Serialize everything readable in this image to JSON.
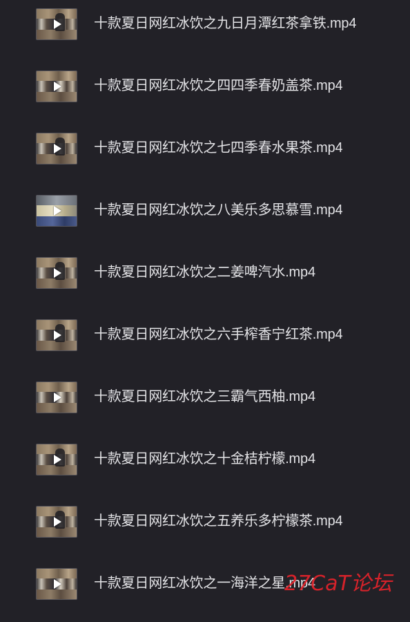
{
  "files": [
    {
      "name": "十款夏日网红冰饮之九日月潭红茶拿铁.mp4",
      "thumbnail_icon": "video-thumbnail",
      "overlay_icon": "play-icon"
    },
    {
      "name": "十款夏日网红冰饮之四四季春奶盖茶.mp4",
      "thumbnail_icon": "video-thumbnail",
      "overlay_icon": "play-icon"
    },
    {
      "name": "十款夏日网红冰饮之七四季春水果茶.mp4",
      "thumbnail_icon": "video-thumbnail",
      "overlay_icon": "play-icon"
    },
    {
      "name": "十款夏日网红冰饮之八美乐多思慕雪.mp4",
      "thumbnail_icon": "video-thumbnail",
      "overlay_icon": "play-icon"
    },
    {
      "name": "十款夏日网红冰饮之二姜啤汽水.mp4",
      "thumbnail_icon": "video-thumbnail",
      "overlay_icon": "play-icon"
    },
    {
      "name": "十款夏日网红冰饮之六手榨香宁红茶.mp4",
      "thumbnail_icon": "video-thumbnail",
      "overlay_icon": "play-icon"
    },
    {
      "name": "十款夏日网红冰饮之三霸气西柚.mp4",
      "thumbnail_icon": "video-thumbnail",
      "overlay_icon": "play-icon"
    },
    {
      "name": "十款夏日网红冰饮之十金桔柠檬.mp4",
      "thumbnail_icon": "video-thumbnail",
      "overlay_icon": "play-icon"
    },
    {
      "name": "十款夏日网红冰饮之五养乐多柠檬茶.mp4",
      "thumbnail_icon": "video-thumbnail",
      "overlay_icon": "play-icon"
    },
    {
      "name": "十款夏日网红冰饮之一海洋之星.mp4",
      "thumbnail_icon": "video-thumbnail",
      "overlay_icon": "play-icon"
    }
  ],
  "watermark": {
    "text": "27CaT论坛"
  },
  "colors": {
    "background": "#222127",
    "text": "#e3e3e6",
    "watermark": "#e0232b"
  }
}
